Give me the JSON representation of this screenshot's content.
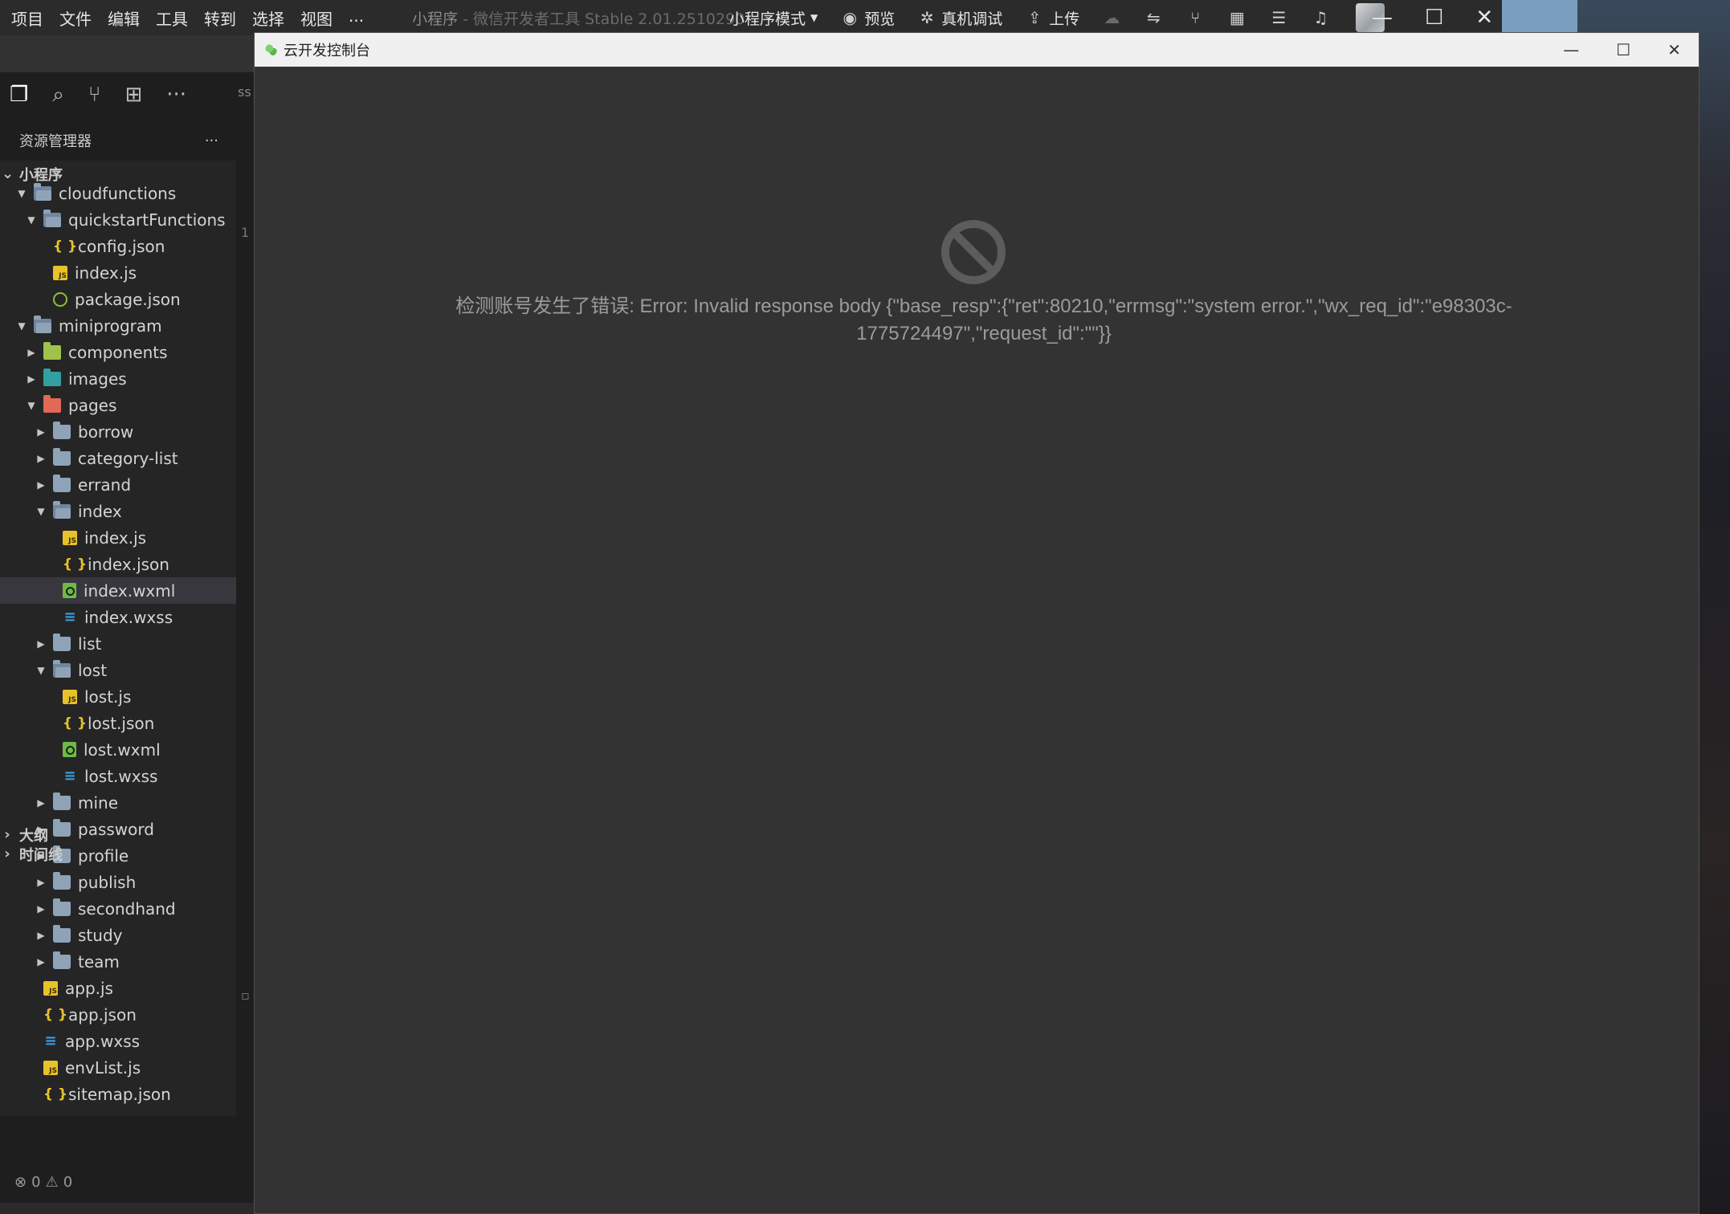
{
  "menus": [
    "项目",
    "文件",
    "编辑",
    "工具",
    "转到",
    "选择",
    "视图",
    "..."
  ],
  "app_title": {
    "name": "小程序",
    "separator": " - ",
    "product": "微信开发者工具 Stable 2.01.2510290"
  },
  "toolbar": {
    "mode": "小程序模式",
    "preview": "预览",
    "device_debug": "真机调试",
    "upload": "上传"
  },
  "ide": {
    "editor_tab_fragment": "ss",
    "explorer_title": "资源管理器",
    "explorer_more": "···",
    "root_label": "小程序",
    "outline_label": "大纲",
    "timeline_label": "时间线",
    "status": {
      "errors": "0",
      "warnings": "0"
    }
  },
  "tree": [
    {
      "label": "cloudfunctions",
      "icon": "folder-open",
      "depth": 1,
      "expanded": true
    },
    {
      "label": "quickstartFunctions",
      "icon": "folder-open",
      "depth": 2,
      "expanded": true
    },
    {
      "label": "config.json",
      "icon": "json",
      "depth": 3
    },
    {
      "label": "index.js",
      "icon": "js",
      "depth": 3
    },
    {
      "label": "package.json",
      "icon": "pkg",
      "depth": 3
    },
    {
      "label": "miniprogram",
      "icon": "folder-open",
      "depth": 1,
      "expanded": true
    },
    {
      "label": "components",
      "icon": "folder-green",
      "depth": 2,
      "expanded": false
    },
    {
      "label": "images",
      "icon": "folder-teal",
      "depth": 2,
      "expanded": false
    },
    {
      "label": "pages",
      "icon": "folder-red",
      "depth": 2,
      "expanded": true
    },
    {
      "label": "borrow",
      "icon": "folder",
      "depth": 3,
      "expanded": false
    },
    {
      "label": "category-list",
      "icon": "folder",
      "depth": 3,
      "expanded": false
    },
    {
      "label": "errand",
      "icon": "folder",
      "depth": 3,
      "expanded": false
    },
    {
      "label": "index",
      "icon": "folder-open",
      "depth": 3,
      "expanded": true
    },
    {
      "label": "index.js",
      "icon": "js",
      "depth": 4
    },
    {
      "label": "index.json",
      "icon": "json",
      "depth": 4
    },
    {
      "label": "index.wxml",
      "icon": "wxml",
      "depth": 4,
      "selected": true
    },
    {
      "label": "index.wxss",
      "icon": "wxss",
      "depth": 4
    },
    {
      "label": "list",
      "icon": "folder",
      "depth": 3,
      "expanded": false
    },
    {
      "label": "lost",
      "icon": "folder-open",
      "depth": 3,
      "expanded": true
    },
    {
      "label": "lost.js",
      "icon": "js",
      "depth": 4
    },
    {
      "label": "lost.json",
      "icon": "json",
      "depth": 4
    },
    {
      "label": "lost.wxml",
      "icon": "wxml",
      "depth": 4
    },
    {
      "label": "lost.wxss",
      "icon": "wxss",
      "depth": 4
    },
    {
      "label": "mine",
      "icon": "folder",
      "depth": 3,
      "expanded": false
    },
    {
      "label": "password",
      "icon": "folder",
      "depth": 3,
      "expanded": false
    },
    {
      "label": "profile",
      "icon": "folder",
      "depth": 3,
      "expanded": false
    },
    {
      "label": "publish",
      "icon": "folder",
      "depth": 3,
      "expanded": false
    },
    {
      "label": "secondhand",
      "icon": "folder",
      "depth": 3,
      "expanded": false
    },
    {
      "label": "study",
      "icon": "folder",
      "depth": 3,
      "expanded": false
    },
    {
      "label": "team",
      "icon": "folder",
      "depth": 3,
      "expanded": false
    },
    {
      "label": "app.js",
      "icon": "js",
      "depth": 2
    },
    {
      "label": "app.json",
      "icon": "json",
      "depth": 2
    },
    {
      "label": "app.wxss",
      "icon": "wxss",
      "depth": 2
    },
    {
      "label": "envList.js",
      "icon": "js",
      "depth": 2
    },
    {
      "label": "sitemap.json",
      "icon": "json",
      "depth": 2
    }
  ],
  "dialog": {
    "title": "云开发控制台",
    "error_line1": "检测账号发生了错误: Error: Invalid response body {\"base_resp\":{\"ret\":80210,\"errmsg\":\"system error.\",\"wx_req_id\":\"e98303c-",
    "error_line2": "1775724497\",\"request_id\":\"\"}}"
  },
  "colors": {
    "dialog_bg": "#333333",
    "error_text": "#9b9b9b",
    "error_icon": "#5c5c5c",
    "sidebar_bg": "#252526",
    "selected_row": "#37373d"
  }
}
